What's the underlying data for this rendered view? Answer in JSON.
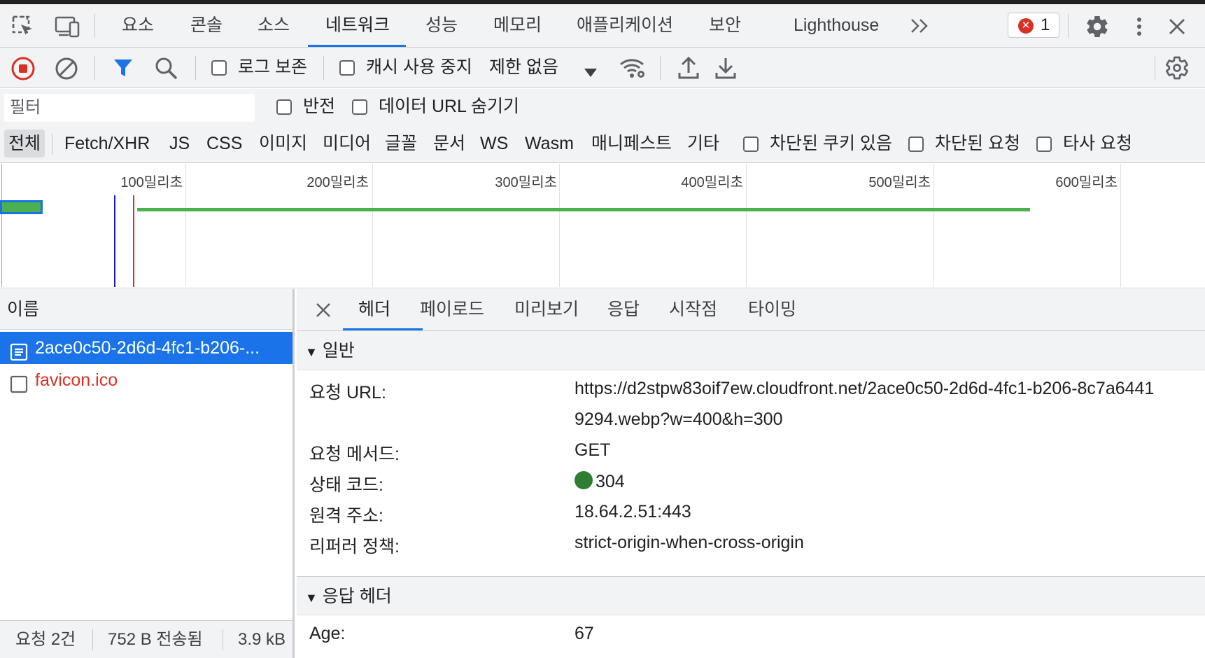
{
  "main_tabs": [
    "요소",
    "콘솔",
    "소스",
    "네트워크",
    "성능",
    "메모리",
    "애플리케이션",
    "보안",
    "Lighthouse"
  ],
  "more_tabs_icon": "chevron-double-right-icon",
  "error_count": "1",
  "toolbar": {
    "preserve_log_label": "로그 보존",
    "disable_cache_label": "캐시 사용 중지",
    "throttling_value": "제한 없음"
  },
  "filter": {
    "placeholder": "필터",
    "invert_label": "반전",
    "hide_data_urls_label": "데이터 URL 숨기기"
  },
  "type_filters": [
    "전체",
    "Fetch/XHR",
    "JS",
    "CSS",
    "이미지",
    "미디어",
    "글꼴",
    "문서",
    "WS",
    "Wasm",
    "매니페스트",
    "기타"
  ],
  "extra_filters": {
    "blocked_cookies_label": "차단된 쿠키 있음",
    "blocked_requests_label": "차단된 요청",
    "third_party_label": "타사 요청"
  },
  "timeline": {
    "ticks": [
      "100밀리초",
      "200밀리초",
      "300밀리초",
      "400밀리초",
      "500밀리초",
      "600밀리초"
    ]
  },
  "requests_pane": {
    "header": "이름",
    "requests": [
      {
        "name": "2ace0c50-2d6d-4fc1-b206-...",
        "selected": true
      },
      {
        "name": "favicon.ico",
        "selected": false,
        "color": "#d93025"
      }
    ],
    "status": {
      "requests": "요청 2건",
      "transferred": "752 B 전송됨",
      "resources": "3.9 kB"
    }
  },
  "details": {
    "tabs": [
      "헤더",
      "페이로드",
      "미리보기",
      "응답",
      "시작점",
      "타이밍"
    ],
    "general_title": "일반",
    "general": {
      "url_key": "요청 URL:",
      "url_line1": "https://d2stpw83oif7ew.cloudfront.net/2ace0c50-2d6d-4fc1-b206-8c7a6441",
      "url_line2": "9294.webp?w=400&h=300",
      "method_key": "요청 메서드:",
      "method_value": "GET",
      "status_key": "상태 코드:",
      "status_value": "304",
      "status_color": "#2e7d32",
      "remote_key": "원격 주소:",
      "remote_value": "18.64.2.51:443",
      "referrer_key": "리퍼러 정책:",
      "referrer_value": "strict-origin-when-cross-origin"
    },
    "response_headers_title": "응답 헤더",
    "response_headers": [
      {
        "key": "Age:",
        "value": "67"
      }
    ]
  }
}
